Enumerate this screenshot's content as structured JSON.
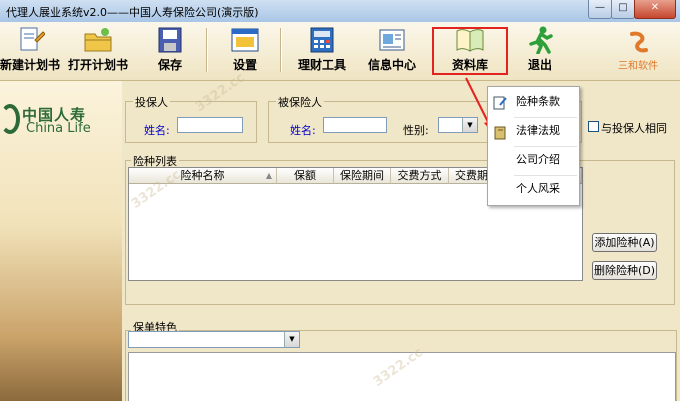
{
  "window": {
    "title": "代理人展业系统v2.0——中国人寿保险公司(演示版)",
    "controls": [
      "—",
      "□",
      "✕"
    ]
  },
  "toolbar": {
    "buttons": [
      {
        "id": "new-plan",
        "label": "新建计划书",
        "icon": "new-document-icon"
      },
      {
        "id": "open-plan",
        "label": "打开计划书",
        "icon": "open-folder-icon"
      },
      {
        "id": "save",
        "label": "保存",
        "icon": "save-icon"
      },
      {
        "id": "settings",
        "label": "设置",
        "icon": "settings-window-icon"
      },
      {
        "id": "finance-tools",
        "label": "理财工具",
        "icon": "calculator-icon"
      },
      {
        "id": "info-center",
        "label": "信息中心",
        "icon": "info-document-icon"
      },
      {
        "id": "library",
        "label": "资料库",
        "icon": "open-book-icon"
      },
      {
        "id": "exit",
        "label": "退出",
        "icon": "running-man-icon"
      }
    ],
    "brand": "三和软件",
    "brand_color": "#e07a2a",
    "highlight_color": "#e3231f"
  },
  "brand": {
    "name_cn": "中国人寿",
    "name_en": "China Life",
    "color": "#2d6a3a"
  },
  "policyholder": {
    "title": "投保人",
    "name_label": "姓名:",
    "name_value": ""
  },
  "insured": {
    "title": "被保险人",
    "name_label": "姓名:",
    "name_value": "",
    "gender_label": "性别:",
    "gender_value": "",
    "same_checkbox_label": "与投保人相同",
    "same_checked": false
  },
  "risk_list": {
    "title": "险种列表",
    "columns": [
      "险种名称",
      "保额",
      "保险期间",
      "交费方式",
      "交费期"
    ],
    "rows": []
  },
  "actions": {
    "add": "添加险种(A)",
    "remove": "删除险种(D)"
  },
  "policy_features": {
    "title": "保单特色",
    "selected": ""
  },
  "dropdown_menu": {
    "items": [
      {
        "label": "险种条款",
        "icon": "edit-document-icon"
      },
      {
        "label": "法律法规",
        "icon": "law-book-icon"
      },
      {
        "label": "公司介绍",
        "icon": ""
      },
      {
        "label": "个人风采",
        "icon": ""
      }
    ]
  },
  "watermark": "3322.cc"
}
